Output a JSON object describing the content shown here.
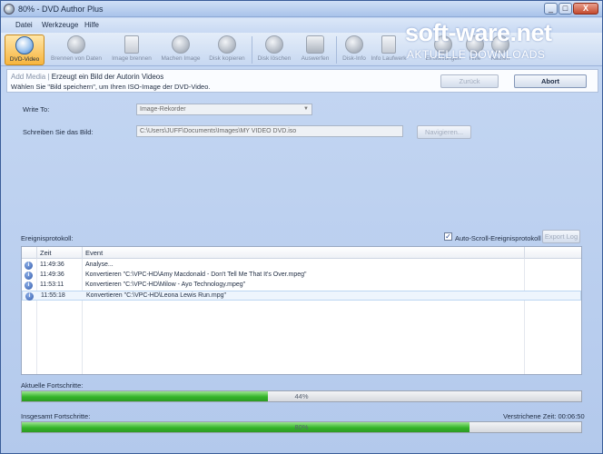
{
  "window": {
    "title": "80% - DVD Author Plus",
    "minimize": "_",
    "maximize": "□",
    "close": "X"
  },
  "menu": [
    "Datei",
    "Werkzeuge",
    "Hilfe"
  ],
  "toolbar": [
    {
      "label": "DVD-Video",
      "icon": "dvd-video-icon",
      "active": true
    },
    {
      "label": "Brennen von Daten",
      "icon": "burn-data-icon"
    },
    {
      "label": "Image brennen",
      "icon": "burn-image-icon"
    },
    {
      "label": "Machen Image",
      "icon": "make-image-icon"
    },
    {
      "label": "Disk kopieren",
      "icon": "copy-disc-icon"
    },
    {
      "label": "Disk löschen",
      "icon": "erase-disc-icon"
    },
    {
      "label": "Auswerfen",
      "icon": "eject-icon"
    },
    {
      "label": "Disk-Info",
      "icon": "disc-info-icon"
    },
    {
      "label": "Info Laufwerk",
      "icon": "drive-info-icon"
    },
    {
      "label": "Einstellungen",
      "icon": "settings-icon"
    },
    {
      "label": "Hilfe",
      "icon": "help-icon"
    },
    {
      "label": "Kaufen",
      "icon": "buy-icon"
    }
  ],
  "watermark": {
    "brand": "soft-ware.net",
    "sub": "AKTUELLE DOWNLOADS"
  },
  "header": {
    "crumb_prefix": "Add Media |",
    "crumb_title": " Erzeugt ein Bild der Autorin Videos",
    "hint": "Wählen Sie \"Bild speichern\", um Ihren ISO-Image der DVD-Video.",
    "back_button": "Zurück",
    "abort_button": "Abort"
  },
  "form": {
    "write_to_label": "Write To:",
    "write_to_value": "Image-Rekorder",
    "save_label": "Schreiben Sie das Bild:",
    "save_path": "C:\\Users\\JUFF\\Documents\\Images\\MY VIDEO DVD.iso",
    "browse_button": "Navigieren..."
  },
  "log": {
    "label": "Ereignisprotokoll:",
    "autoscroll_label": "Auto-Scroll-Ereignisprotokoll",
    "autoscroll_checked": true,
    "export_button": "Export Log",
    "columns": [
      "Zeit",
      "Event"
    ],
    "rows": [
      {
        "time": "11:49:36",
        "event": "Analyse..."
      },
      {
        "time": "11:49:36",
        "event": "Konvertieren \"C:\\VPC-HD\\Amy Macdonald - Don't Tell Me That It's Over.mpeg\""
      },
      {
        "time": "11:53:11",
        "event": "Konvertieren \"C:\\VPC-HD\\Milow - Ayo Technology.mpeg\""
      },
      {
        "time": "11:55:18",
        "event": "Konvertieren \"C:\\VPC-HD\\Leona Lewis Run.mpg\""
      }
    ]
  },
  "progress": {
    "current_label": "Aktuelle Fortschritte:",
    "current_percent": 44,
    "current_text": "44%",
    "total_label": "Insgesamt Fortschritte:",
    "total_percent": 80,
    "total_text": "80%",
    "elapsed_label": "Verstrichene Zeit:",
    "elapsed_value": "00:06:50"
  }
}
